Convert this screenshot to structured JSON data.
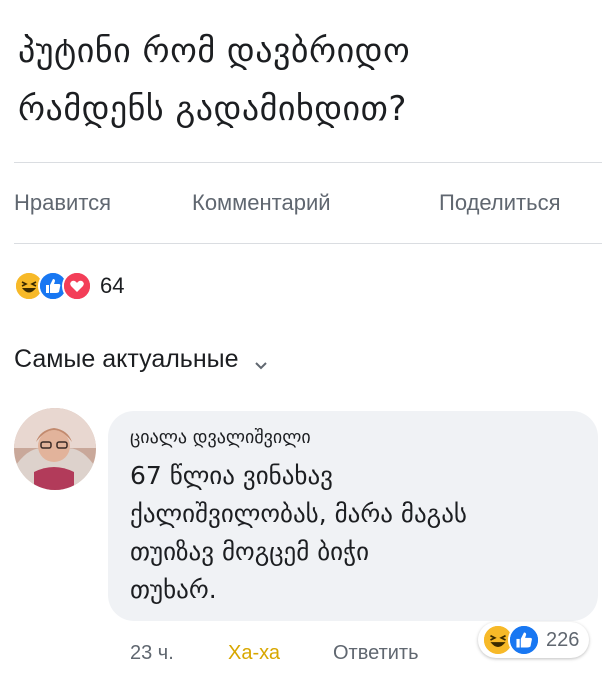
{
  "post": {
    "text_line1": "პუტინი რომ დავბრიდო",
    "text_line2": "რამდენს გადამიხდით?"
  },
  "actions": {
    "like": "Нравится",
    "comment": "Комментарий",
    "share": "Поделиться"
  },
  "reactions": {
    "icons": [
      "haha-icon",
      "like-icon",
      "love-icon"
    ],
    "count": "64"
  },
  "sort": {
    "label": "Самые актуальные"
  },
  "comment": {
    "author": "ციალა დვალიშვილი",
    "line1": "67 წლია ვინახავ",
    "line2": "ქალიშვილობას, მარა მაგას",
    "line3": "თუიზავ მოგცემ ბიჭი",
    "line4": "თუხარ.",
    "time": "23 ч.",
    "haha": "Ха-ха",
    "reply": "Ответить",
    "reaction_icons": [
      "haha-icon",
      "like-icon"
    ],
    "reaction_count": "226"
  },
  "colors": {
    "like_blue": "#1877f2",
    "love_red": "#f33e58",
    "haha_yellow": "#f7b928",
    "haha_text": "#d8a700",
    "secondary_text": "#606770",
    "bubble_bg": "#f0f2f5"
  }
}
